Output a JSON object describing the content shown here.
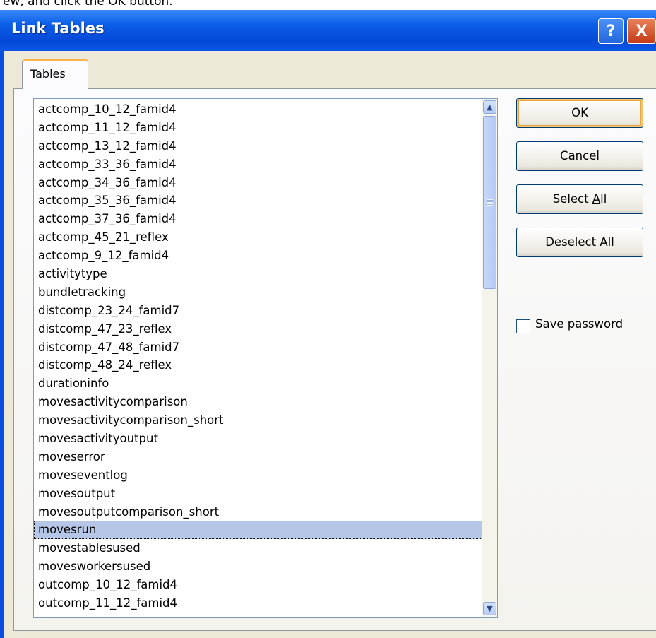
{
  "top_strip": {
    "text": "ew, and click the OK button."
  },
  "window": {
    "title": "Link Tables",
    "help_glyph": "?",
    "close_glyph": "X"
  },
  "tabs": [
    {
      "label": "Tables"
    }
  ],
  "list": {
    "items": [
      "actcomp_10_12_famid4",
      "actcomp_11_12_famid4",
      "actcomp_13_12_famid4",
      "actcomp_33_36_famid4",
      "actcomp_34_36_famid4",
      "actcomp_35_36_famid4",
      "actcomp_37_36_famid4",
      "actcomp_45_21_reflex",
      "actcomp_9_12_famid4",
      "activitytype",
      "bundletracking",
      "distcomp_23_24_famid7",
      "distcomp_47_23_reflex",
      "distcomp_47_48_famid7",
      "distcomp_48_24_reflex",
      "durationinfo",
      "movesactivitycomparison",
      "movesactivitycomparison_short",
      "movesactivityoutput",
      "moveserror",
      "moveseventlog",
      "movesoutput",
      "movesoutputcomparison_short",
      "movesrun",
      "movestablesused",
      "movesworkersused",
      "outcomp_10_12_famid4",
      "outcomp_11_12_famid4"
    ],
    "selected": "movesrun"
  },
  "buttons": {
    "ok": {
      "label": "OK"
    },
    "cancel": {
      "label": "Cancel"
    },
    "select_all": {
      "pre": "Select ",
      "accel": "A",
      "post": "ll"
    },
    "deselect_all": {
      "pre": "D",
      "accel": "e",
      "post": "select All"
    }
  },
  "save_password": {
    "pre": "Sa",
    "accel": "v",
    "post": "e password",
    "checked": false
  },
  "icons": {
    "scroll_up": "chevron-up-icon",
    "scroll_down": "chevron-down-icon",
    "help": "question-icon",
    "close": "close-icon"
  },
  "colors": {
    "titlebar": "#0a56e2",
    "default_button_border": "#e8a540",
    "selection": "#b6c6e6",
    "close_button": "#c63b17"
  }
}
